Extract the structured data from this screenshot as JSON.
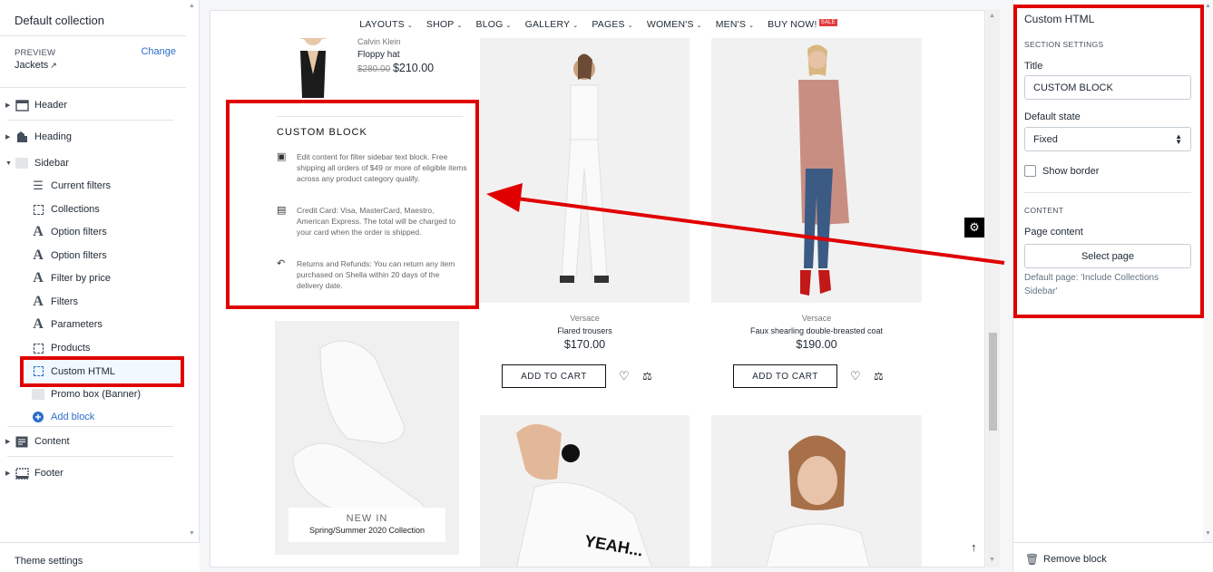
{
  "left_panel": {
    "title": "Default collection",
    "preview_label": "PREVIEW",
    "change_link": "Change",
    "preview_value": "Jackets",
    "sections": [
      {
        "label": "Header"
      },
      {
        "label": "Heading"
      },
      {
        "label": "Sidebar"
      },
      {
        "label": "Content"
      },
      {
        "label": "Footer"
      }
    ],
    "sidebar_blocks": [
      {
        "label": "Current filters"
      },
      {
        "label": "Collections"
      },
      {
        "label": "Option filters"
      },
      {
        "label": "Option filters"
      },
      {
        "label": "Filter by price"
      },
      {
        "label": "Filters"
      },
      {
        "label": "Parameters"
      },
      {
        "label": "Products"
      },
      {
        "label": "Custom HTML"
      },
      {
        "label": "Promo box (Banner)"
      }
    ],
    "add_block": "Add block",
    "theme_settings": "Theme settings"
  },
  "preview": {
    "nav": [
      {
        "label": "LAYOUTS"
      },
      {
        "label": "SHOP"
      },
      {
        "label": "BLOG"
      },
      {
        "label": "GALLERY"
      },
      {
        "label": "PAGES"
      },
      {
        "label": "WOMEN'S"
      },
      {
        "label": "MEN'S"
      },
      {
        "label": "BUY NOW!"
      }
    ],
    "sale_badge": "SALE",
    "sidebar_product": {
      "brand": "Calvin Klein",
      "name": "Floppy hat",
      "old_price": "$280.00",
      "price": "$210.00"
    },
    "custom_block": {
      "title": "CUSTOM BLOCK",
      "items": [
        {
          "icon": "gift-box-icon",
          "text": "Edit content for filter sidebar text block. Free shipping all orders of $49 or more of eligible items across any product category qualify."
        },
        {
          "icon": "credit-card-icon",
          "text": "Credit Card: Visa, MasterCard, Maestro, American Express. The total will be charged to your card when the order is shipped."
        },
        {
          "icon": "return-arrow-icon",
          "text": "Returns and Refunds: You can return any item purchased on Shella within 20 days of the delivery date."
        }
      ]
    },
    "promo": {
      "heading": "NEW IN",
      "sub": "Spring/Summer 2020 Collection"
    },
    "products": [
      {
        "brand": "Versace",
        "name": "Flared trousers",
        "price": "$170.00",
        "cart": "ADD TO CART"
      },
      {
        "brand": "Versace",
        "name": "Faux shearling double-breasted coat",
        "price": "$190.00",
        "cart": "ADD TO CART"
      }
    ],
    "tshirt_text": "YEAH..."
  },
  "right_panel": {
    "title": "Custom HTML",
    "section_settings": "SECTION SETTINGS",
    "title_label": "Title",
    "title_value": "CUSTOM BLOCK",
    "default_state_label": "Default state",
    "default_state_value": "Fixed",
    "show_border": "Show border",
    "content_heading": "CONTENT",
    "page_content_label": "Page content",
    "select_page": "Select page",
    "help": "Default page: 'Include Collections Sidebar'",
    "remove": "Remove block"
  },
  "colors": {
    "annotation": "#e00000",
    "link": "#2c6ecb",
    "sale": "#e23c3c"
  }
}
